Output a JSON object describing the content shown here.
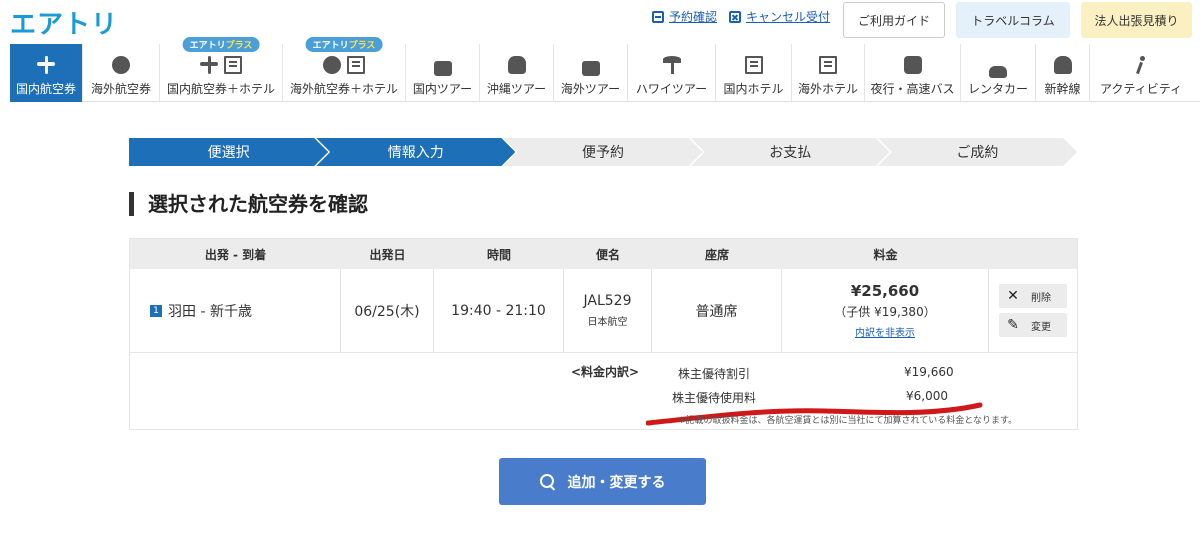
{
  "logo": "エアトリ",
  "top_links": {
    "reservation": "予約確認",
    "cancel": "キャンセル受付"
  },
  "top_buttons": {
    "guide": "ご利用ガイド",
    "column": "トラベルコラム",
    "corporate": "法人出張見積り"
  },
  "nav": {
    "badge_prefix": "エアトリ",
    "badge_suffix": "プラス",
    "items": [
      {
        "label": "国内航空券",
        "icon": "plane-icon"
      },
      {
        "label": "海外航空券",
        "icon": "globe-plane-icon"
      },
      {
        "label": "国内航空券＋ホテル",
        "icon": "plane-hotel-icon"
      },
      {
        "label": "海外航空券＋ホテル",
        "icon": "globe-hotel-icon"
      },
      {
        "label": "国内ツアー",
        "icon": "suitcase-icon"
      },
      {
        "label": "沖縄ツアー",
        "icon": "shisa-icon"
      },
      {
        "label": "海外ツアー",
        "icon": "suitcase-icon"
      },
      {
        "label": "ハワイツアー",
        "icon": "palm-icon"
      },
      {
        "label": "国内ホテル",
        "icon": "hotel-icon"
      },
      {
        "label": "海外ホテル",
        "icon": "hotel-icon"
      },
      {
        "label": "夜行・高速バス",
        "icon": "bus-icon"
      },
      {
        "label": "レンタカー",
        "icon": "car-icon"
      },
      {
        "label": "新幹線",
        "icon": "train-icon"
      },
      {
        "label": "アクティビティ",
        "icon": "runner-icon"
      }
    ]
  },
  "steps": [
    "便選択",
    "情報入力",
    "便予約",
    "お支払",
    "ご成約"
  ],
  "page_title": "選択された航空券を確認",
  "table": {
    "headers": [
      "出発 - 到着",
      "出発日",
      "時間",
      "便名",
      "座席",
      "料金"
    ],
    "row": {
      "index": "1",
      "route": "羽田 - 新千歳",
      "date": "06/25(木)",
      "time": "19:40 - 21:10",
      "flight_no": "JAL529",
      "airline": "日本航空",
      "seat": "普通席",
      "price": "¥25,660",
      "child_price": "（子供 ¥19,380）",
      "hide_breakdown": "内訳を非表示",
      "delete_label": "削除",
      "change_label": "変更"
    },
    "breakdown": {
      "label": "<料金内訳>",
      "item1_label": "株主優待割引",
      "item1_value": "¥19,660",
      "item2_label": "株主優待使用料",
      "item2_value": "¥6,000",
      "note": "※記載の取扱料金は、各航空運賃とは別に当社にて加算されている料金となります。"
    }
  },
  "action_button": "追加・変更する",
  "colors": {
    "brand": "#1a9bd7",
    "active": "#1d6fb8",
    "button": "#4a7ccc",
    "annotation": "#d01818"
  }
}
